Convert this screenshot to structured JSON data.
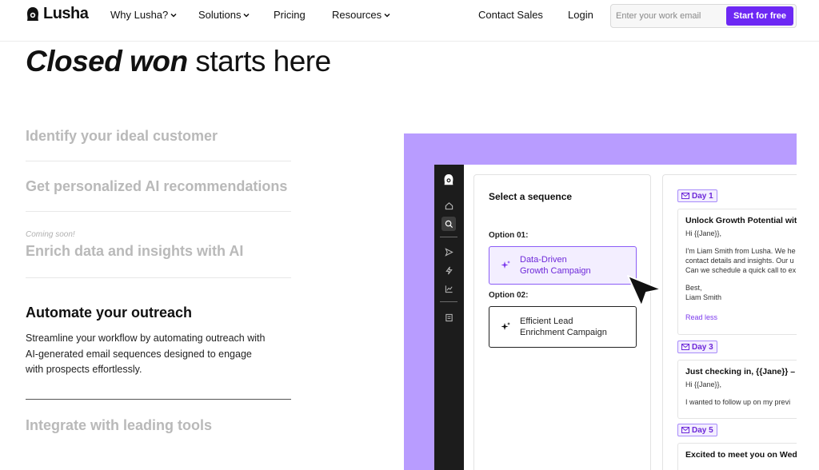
{
  "nav": {
    "brand": "Lusha",
    "items": [
      {
        "label": "Why Lusha?",
        "has_dropdown": true
      },
      {
        "label": "Solutions",
        "has_dropdown": true
      },
      {
        "label": "Pricing",
        "has_dropdown": false
      },
      {
        "label": "Resources",
        "has_dropdown": true
      }
    ],
    "contact_sales": "Contact Sales",
    "login": "Login",
    "email_placeholder": "Enter your work email",
    "cta": "Start for free",
    "accent": "#6d28f4"
  },
  "hero": {
    "headline_strong": "Closed won",
    "headline_rest": " starts here"
  },
  "features": [
    {
      "title": "Identify your ideal customer"
    },
    {
      "title": "Get personalized AI recommendations"
    },
    {
      "title": "Enrich data and insights with AI",
      "note": "Coming soon!"
    }
  ],
  "active_feature": {
    "title": "Automate your outreach",
    "description": "Streamline your workflow by automating outreach with AI-generated email sequences designed to engage with prospects effortlessly."
  },
  "next_feature": {
    "title": "Integrate with leading tools"
  },
  "demo": {
    "panel_color": "#b89cff",
    "sidebar_icons": [
      "lusha-logo-icon",
      "home-icon",
      "search-icon",
      "send-icon",
      "bolt-icon",
      "chart-icon",
      "document-icon"
    ],
    "sequence": {
      "title": "Select a sequence",
      "options": [
        {
          "label": "Option 01:",
          "name": "Data-Driven\nGrowth Campaign",
          "selected": true
        },
        {
          "label": "Option 02:",
          "name": "Efficient Lead\nEnrichment Campaign",
          "selected": false
        }
      ]
    },
    "emails": [
      {
        "day": "Day 1",
        "subject": "Unlock Growth Potential wit",
        "lines": [
          "Hi {{Jane}},",
          "",
          "I'm Liam Smith from Lusha. We he",
          "contact details and insights. Our u",
          "Can we schedule a quick call to ex",
          "",
          "Best,",
          "Liam Smith"
        ],
        "action": "Read less"
      },
      {
        "day": "Day 3",
        "subject": "Just checking in, {{Jane}} –",
        "lines": [
          "Hi {{Jane}},",
          "",
          "I wanted to follow up on my previ"
        ]
      },
      {
        "day": "Day 5",
        "subject": "Excited to meet you on Wed",
        "lines": []
      }
    ]
  }
}
